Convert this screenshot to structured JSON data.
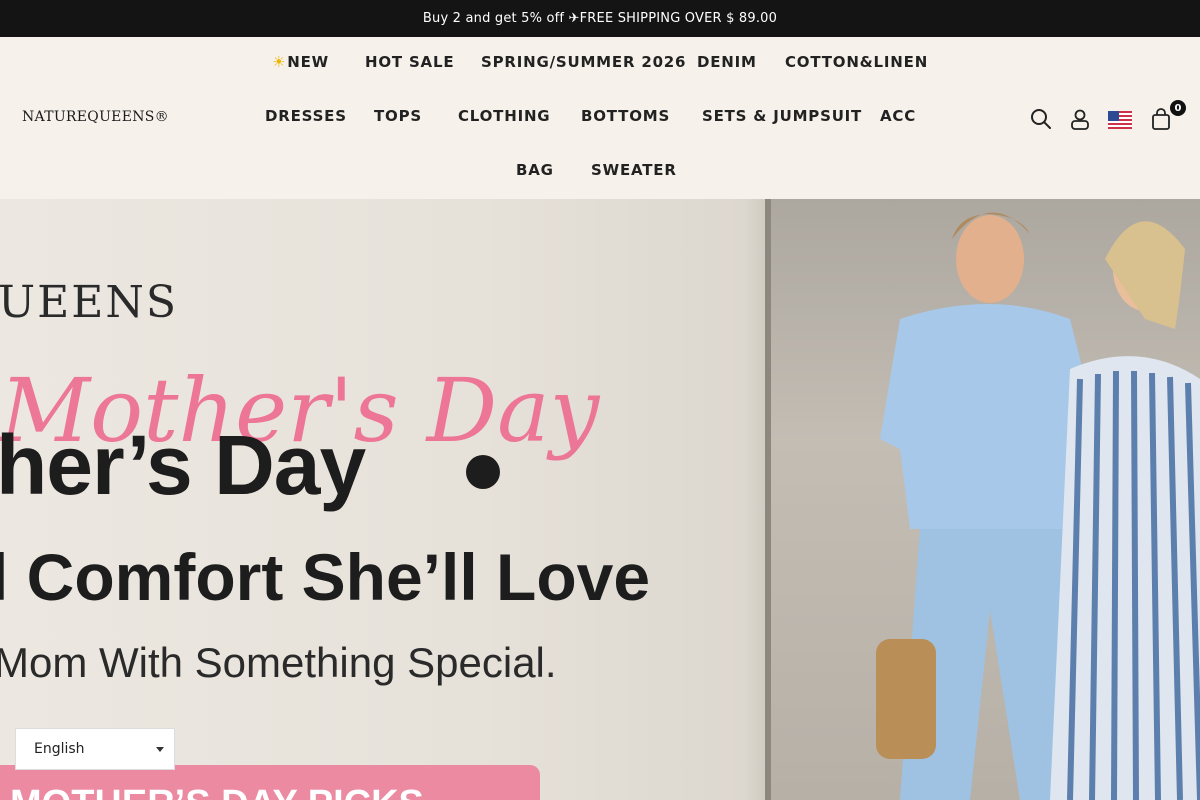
{
  "announcement": "Buy 2 and get 5% off ✈FREE SHIPPING OVER $ 89.00",
  "logo": "NATUREQUEENS®",
  "nav": {
    "row1": [
      "NEW",
      "HOT SALE",
      "SPRING/SUMMER 2026",
      "DENIM",
      "COTTON&LINEN"
    ],
    "row2": [
      "DRESSES",
      "TOPS",
      "CLOTHING",
      "BOTTOMS",
      "SETS & JUMPSUIT",
      "ACC"
    ],
    "row3": [
      "BAG",
      "SWEATER"
    ]
  },
  "header_icons": {
    "search": "search-icon",
    "account": "user-icon",
    "flag": "us-flag-icon",
    "cart": "cart-icon"
  },
  "cart_count": "0",
  "hero": {
    "brand": "UEENS",
    "script": "Mother's Day",
    "title": "her’s Day",
    "subtitle": "l Comfort She’ll Love",
    "tagline": "Mom With Something Special.",
    "cta": "MOTHER’S DAY PICKS"
  },
  "language_selector": {
    "value": "English"
  },
  "colors": {
    "announcement_bg": "#141414",
    "header_bg": "#f6f1ea",
    "script_pink": "#ee6b8f",
    "cta_pink": "#ec8aa1",
    "flag_icon": "sun-icon"
  }
}
